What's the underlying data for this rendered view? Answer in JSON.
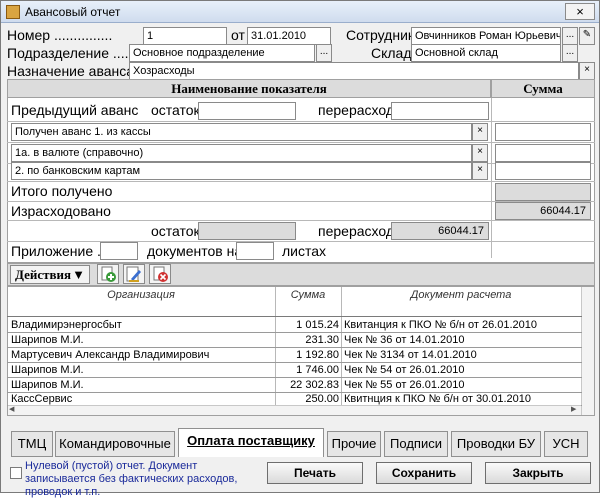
{
  "window": {
    "title": "Авансовый отчет",
    "close": "×"
  },
  "header": {
    "number_label": "Номер ...............",
    "number_value": "1",
    "date_label": "от",
    "date_value": "31.01.2010",
    "employee_label": "Сотрудник",
    "employee_value": "Овчинников Роман Юрьевич",
    "division_label": "Подразделение ......",
    "division_value": "Основное подразделение",
    "warehouse_label": "Склад",
    "warehouse_value": "Основной склад",
    "purpose_label": "Назначение аванса",
    "purpose_value": "Хозрасходы"
  },
  "grid": {
    "col_name": "Наименование показателя",
    "col_sum": "Сумма",
    "prev_advance": "Предыдущий аванс",
    "remainder": "остаток",
    "overspend": "перерасход",
    "row1": "Получен аванс 1. из кассы",
    "row1a": "1а. в валюте (справочно)",
    "row2": "2. по банковским картам",
    "total_received": "Итого получено",
    "spent": "Израсходовано",
    "spent_value": "66044.17",
    "remainder2": "остаток",
    "overspend2": "перерасход",
    "overspend2_value": "66044.17",
    "attachment": "Приложение ...",
    "documents_on": "документов на",
    "sheets": "листах"
  },
  "toolbar": {
    "actions": "Действия"
  },
  "table": {
    "headers": [
      "Организация",
      "Сумма",
      "Документ расчета"
    ],
    "rows": [
      [
        "Владимирэнергосбыт",
        "1 015.24",
        "Квитанция к ПКО № б/н от 26.01.2010"
      ],
      [
        "Шарипов М.И.",
        "231.30",
        "Чек № 36 от 14.01.2010"
      ],
      [
        "Мартусевич Александр Владимирович",
        "1 192.80",
        "Чек № 3134 от 14.01.2010"
      ],
      [
        "Шарипов М.И.",
        "1 746.00",
        "Чек № 54 от 26.01.2010"
      ],
      [
        "Шарипов М.И.",
        "22 302.83",
        "Чек № 55 от 26.01.2010"
      ],
      [
        "КассСервис",
        "250.00",
        "Квитнция к ПКО № б/н от 30.01.2010"
      ]
    ]
  },
  "tabs": [
    "ТМЦ",
    "Командировочные",
    "Оплата поставщику",
    "Прочие",
    "Подписи",
    "Проводки БУ",
    "УСН"
  ],
  "footer": {
    "zero_report": "Нулевой (пустой) отчет. Документ записывается без фактических расходов, проводок и т.п.",
    "print": "Печать",
    "save": "Сохранить",
    "close": "Закрыть"
  }
}
